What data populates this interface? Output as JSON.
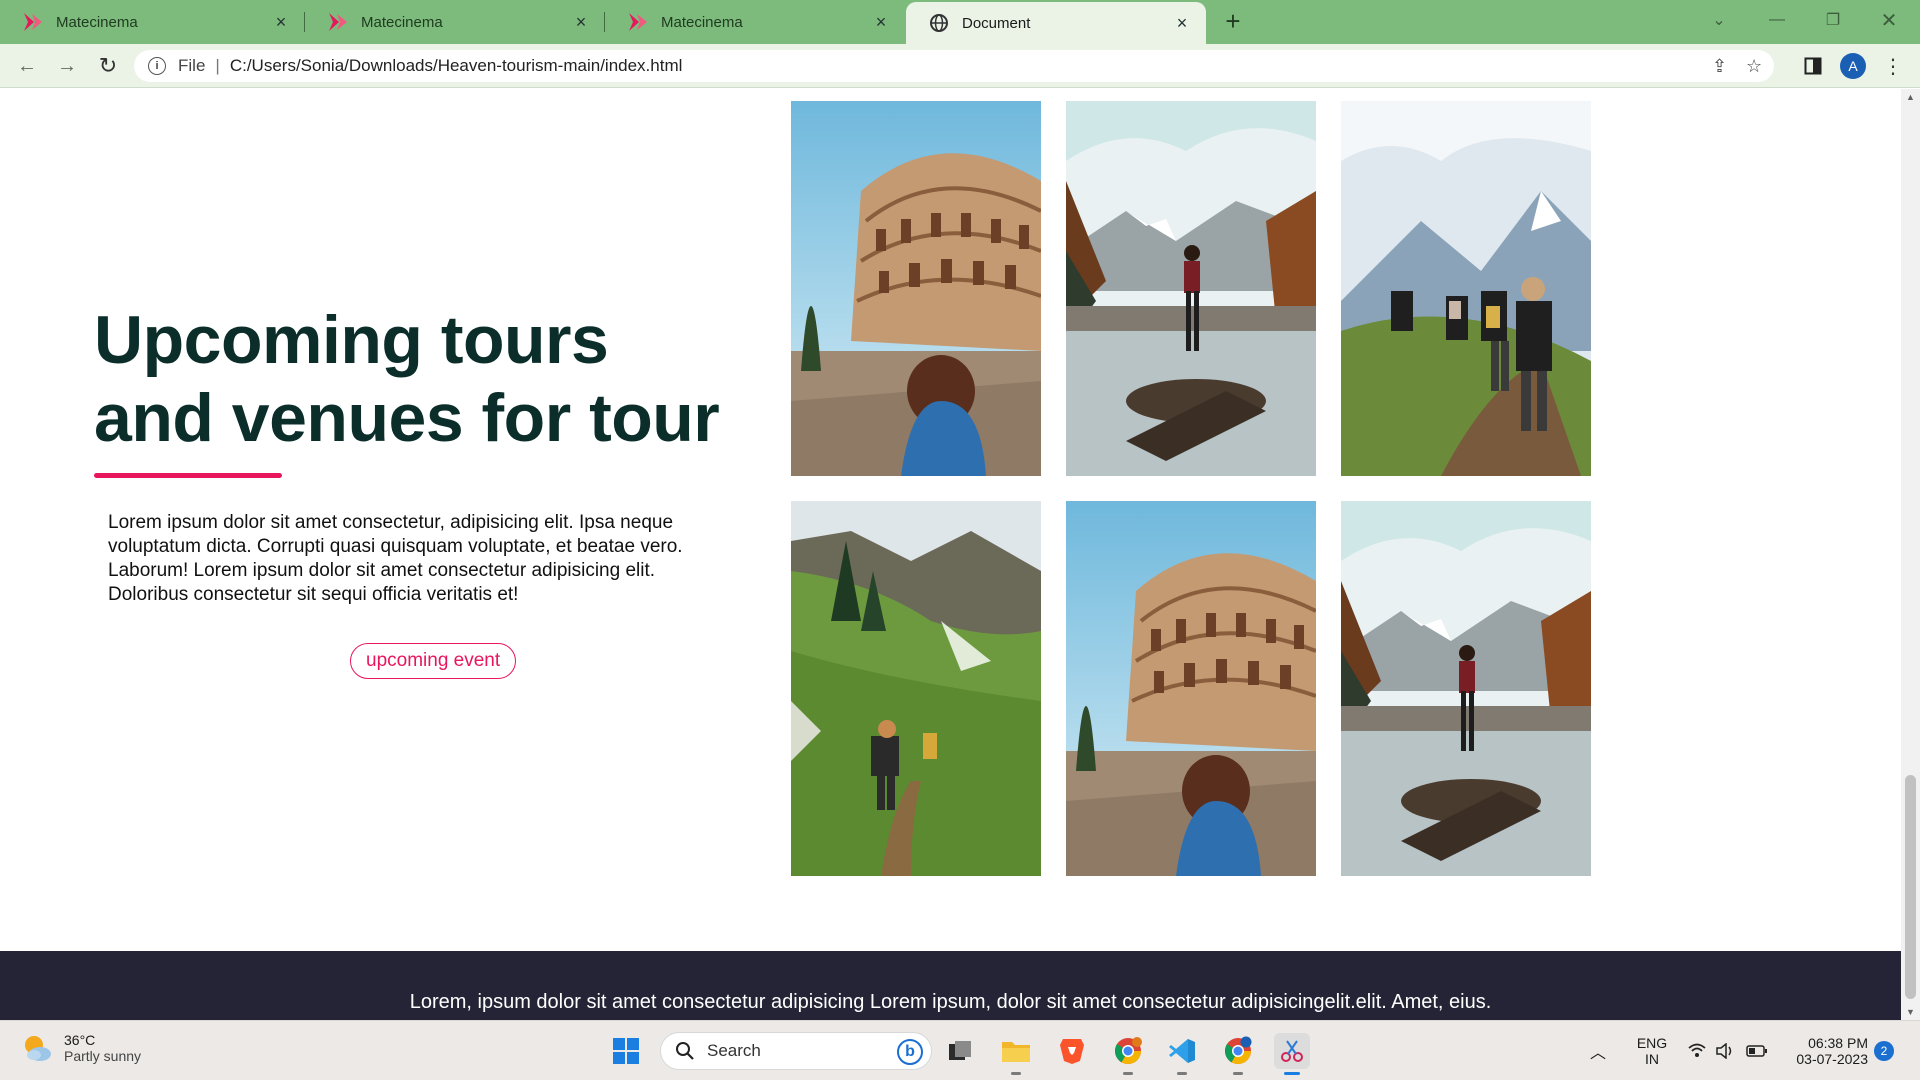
{
  "browser": {
    "tabs": [
      {
        "title": "Matecinema",
        "active": false
      },
      {
        "title": "Matecinema",
        "active": false
      },
      {
        "title": "Matecinema",
        "active": false
      },
      {
        "title": "Document",
        "active": true
      }
    ],
    "omnibox": {
      "scheme_label": "File",
      "url": "C:/Users/Sonia/Downloads/Heaven-tourism-main/index.html"
    },
    "profile_initial": "A",
    "colors": {
      "tabstrip": "#7dbb7d",
      "toolbar": "#eaf3e6"
    }
  },
  "page": {
    "headline": "Upcoming tours and venues for tour",
    "lead": "Lorem ipsum dolor sit amet consectetur, adipisicing elit. Ipsa neque voluptatum dicta. Corrupti quasi quisquam voluptate, et beatae vero. Laborum! Lorem ipsum dolor sit amet consectetur adipisicing elit. Doloribus consectetur sit sequi officia veritatis et!",
    "cta_label": "upcoming event",
    "gallery": [
      {
        "subject": "colosseum"
      },
      {
        "subject": "lake-reflection"
      },
      {
        "subject": "mountain-hikers"
      },
      {
        "subject": "green-valley-hike"
      },
      {
        "subject": "colosseum"
      },
      {
        "subject": "lake-reflection"
      }
    ],
    "footer_text": "Lorem, ipsum dolor sit amet consectetur adipisicing Lorem ipsum, dolor sit amet consectetur adipisicingelit.elit. Amet, eius.",
    "colors": {
      "headline": "#0c2e2a",
      "accent": "#e8175d",
      "footer": "#252436"
    }
  },
  "taskbar": {
    "weather": {
      "temp": "36°C",
      "desc": "Partly sunny"
    },
    "search_label": "Search",
    "language": {
      "line1": "ENG",
      "line2": "IN"
    },
    "clock": {
      "time": "06:38 PM",
      "date": "03-07-2023"
    },
    "notification_count": "2"
  }
}
